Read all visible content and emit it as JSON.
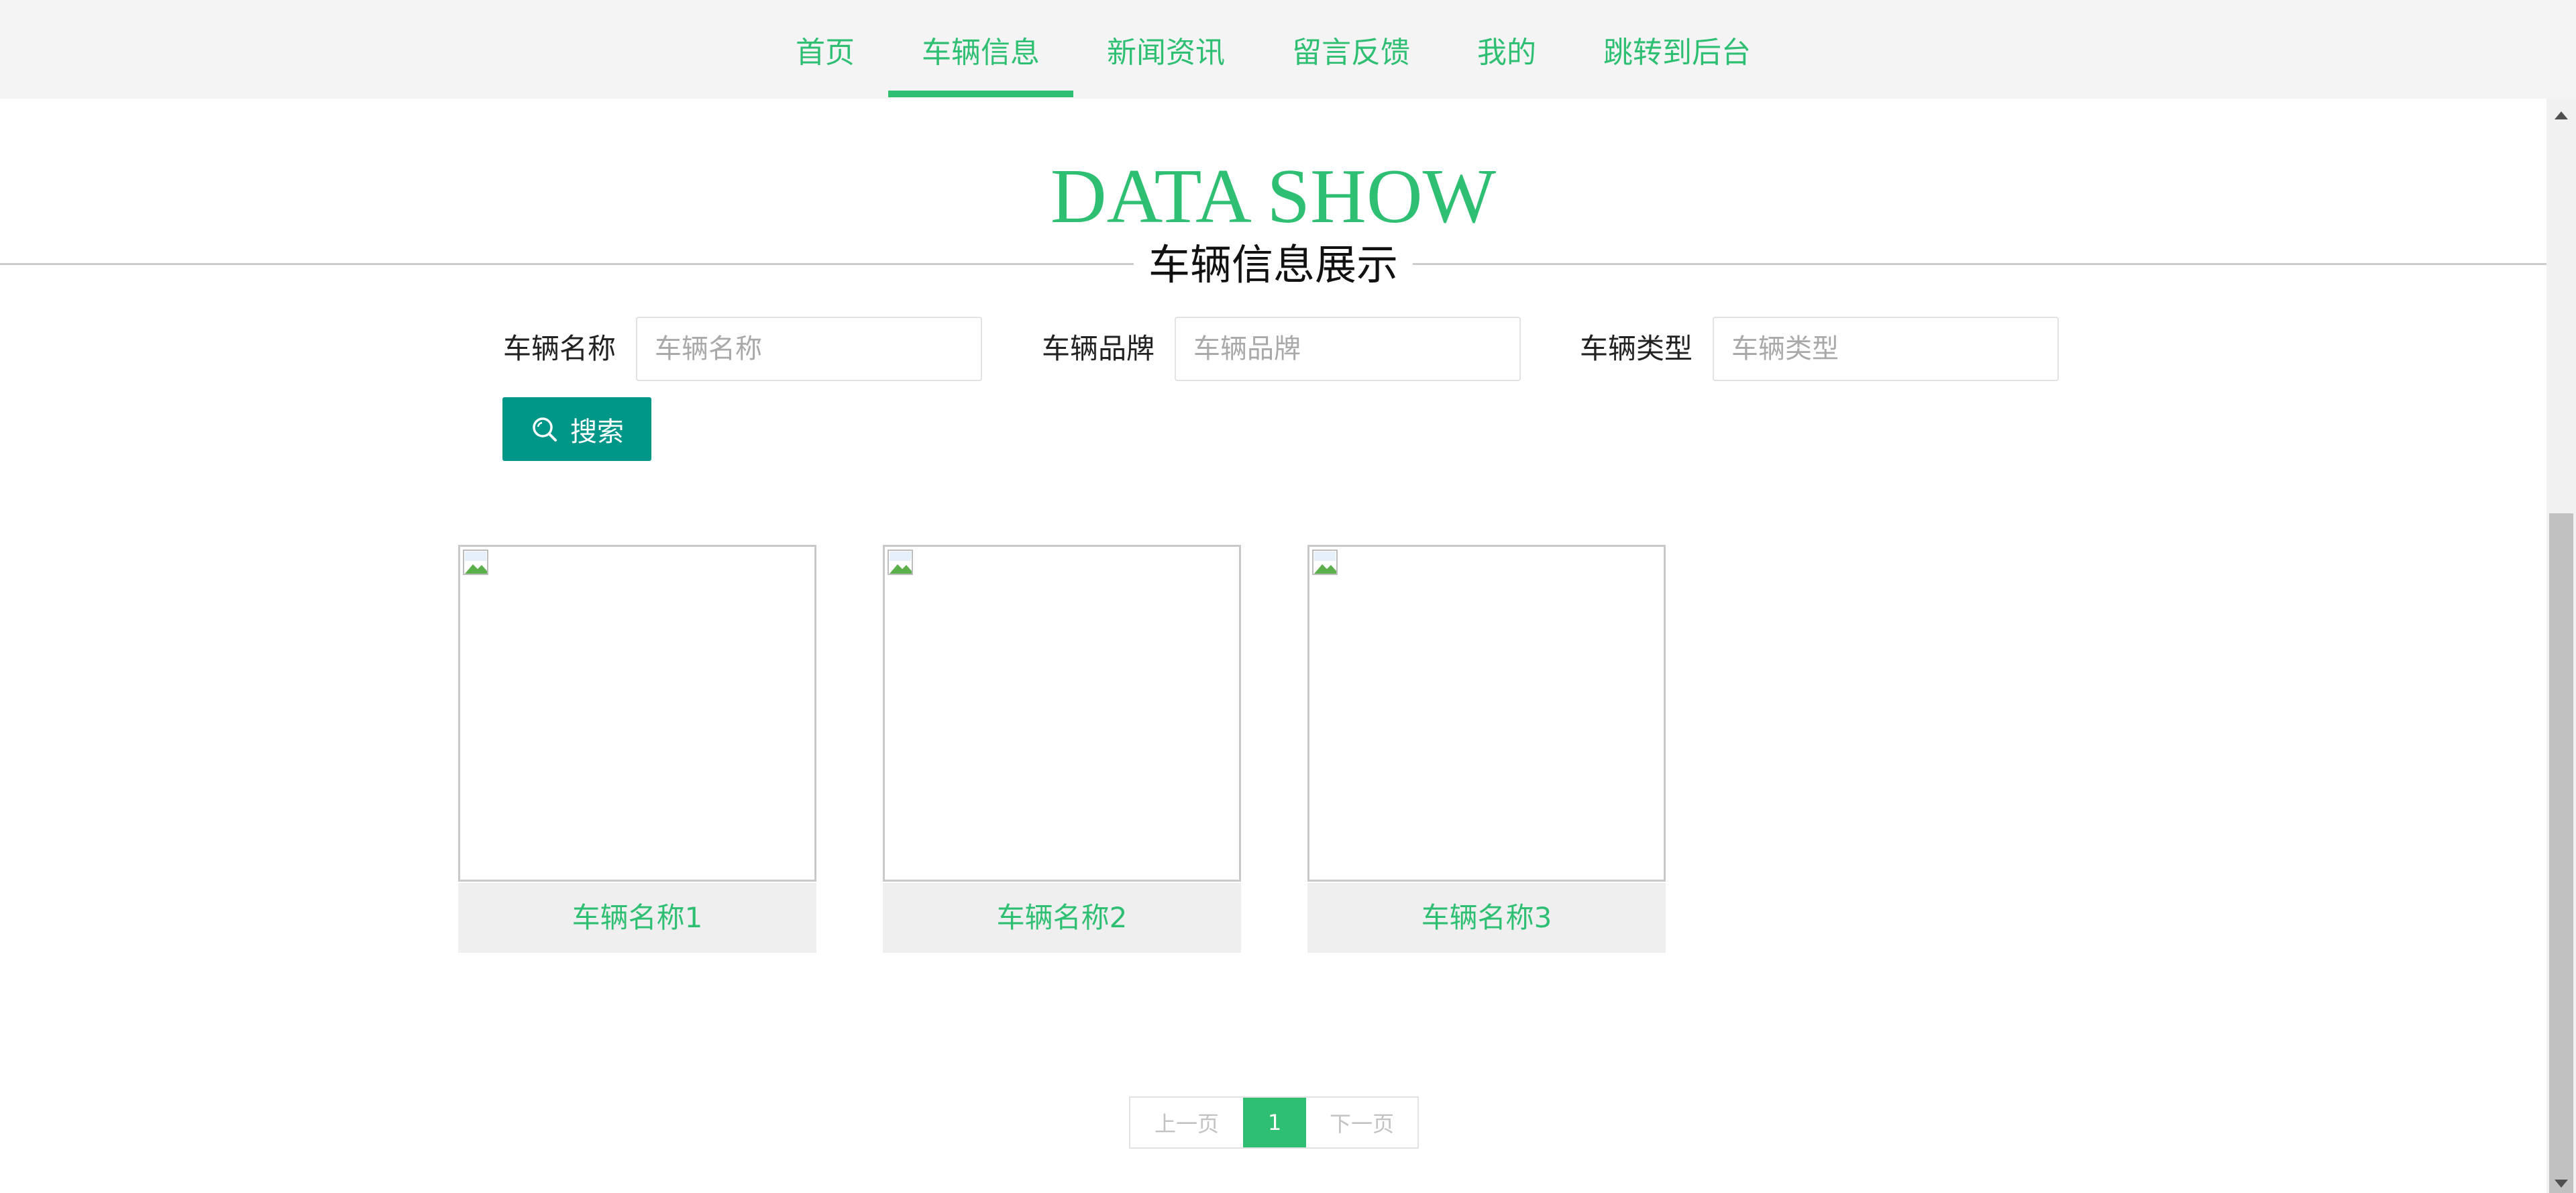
{
  "nav": {
    "items": [
      "首页",
      "车辆信息",
      "新闻资讯",
      "留言反馈",
      "我的",
      "跳转到后台"
    ],
    "active": "车辆信息"
  },
  "title": {
    "en": "DATA SHOW",
    "cn": "车辆信息展示"
  },
  "search": {
    "fields": [
      {
        "label": "车辆名称",
        "placeholder": "车辆名称",
        "value": ""
      },
      {
        "label": "车辆品牌",
        "placeholder": "车辆品牌",
        "value": ""
      },
      {
        "label": "车辆类型",
        "placeholder": "车辆类型",
        "value": ""
      }
    ],
    "button_label": "搜索",
    "button_icon": "search-icon"
  },
  "cards": [
    {
      "name": "车辆名称1"
    },
    {
      "name": "车辆名称2"
    },
    {
      "name": "车辆名称3"
    }
  ],
  "pagination": {
    "prev_label": "上一页",
    "current": "1",
    "next_label": "下一页"
  },
  "colors": {
    "accent": "#2fbf73",
    "button": "#009688",
    "nav_bg": "#f4f4f4",
    "caption_bg": "#efefef"
  }
}
